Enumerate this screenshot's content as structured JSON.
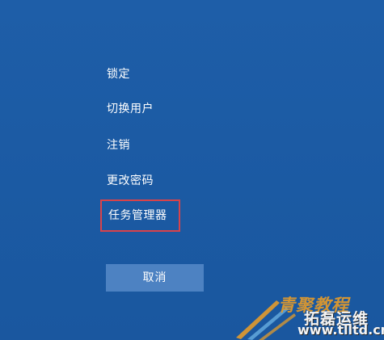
{
  "menu": {
    "items": [
      {
        "label": "锁定"
      },
      {
        "label": "切换用户"
      },
      {
        "label": "注销"
      },
      {
        "label": "更改密码"
      },
      {
        "label": "任务管理器"
      }
    ]
  },
  "cancel_label": "取消",
  "watermark": {
    "line1": "青聚教程",
    "line2": "拓磊运维",
    "line3": "www.tlltd.cn"
  },
  "colors": {
    "background": "#1d5aa3",
    "cancel_button": "#4d82c2",
    "highlight_border": "#d9434a"
  }
}
